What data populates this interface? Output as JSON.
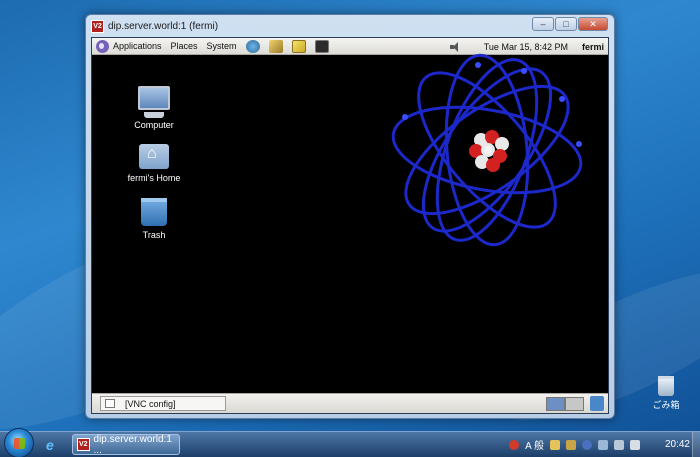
{
  "vnc_window": {
    "title": "dip.server.world:1 (fermi)",
    "icon_text": "V2",
    "controls": {
      "minimize": "–",
      "maximize": "□",
      "close": "✕"
    }
  },
  "gnome_panel": {
    "menus": [
      "Applications",
      "Places",
      "System"
    ],
    "clock": "Tue Mar 15,  8:42 PM",
    "user": "fermi"
  },
  "desktop_icons": [
    {
      "label": "Computer"
    },
    {
      "label": "fermi's Home"
    },
    {
      "label": "Trash"
    }
  ],
  "gnome_bottom_panel": {
    "task": "[VNC config]"
  },
  "host_desktop": {
    "recycle_bin": "ごみ箱"
  },
  "host_taskbar": {
    "task_label": "dip.server.world:1 ...",
    "tray_ime": "A 般",
    "clock": "20:42"
  },
  "colors": {
    "orbit": "#1f2bd6",
    "proton": "#d32020",
    "neutron": "#e8e8e8",
    "accent": "#3f6896"
  }
}
